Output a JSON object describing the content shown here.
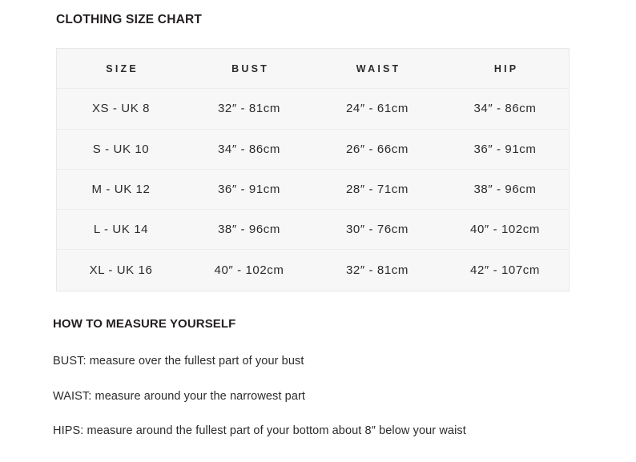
{
  "page": {
    "title": "CLOTHING SIZE CHART",
    "background_color": "#ffffff",
    "text_color": "#2b2b2b"
  },
  "size_table": {
    "background_color": "#f7f7f7",
    "border_color": "#e8e8e8",
    "columns": [
      "SIZE",
      "BUST",
      "WAIST",
      "HIP"
    ],
    "rows": [
      {
        "size": "XS - UK 8",
        "bust": "32″ - 81cm",
        "waist": "24″ - 61cm",
        "hip": "34″ - 86cm"
      },
      {
        "size": "S - UK 10",
        "bust": "34″ - 86cm",
        "waist": "26″ - 66cm",
        "hip": "36″ - 91cm"
      },
      {
        "size": "M - UK 12",
        "bust": "36″ - 91cm",
        "waist": "28″ - 71cm",
        "hip": "38″ - 96cm"
      },
      {
        "size": "L - UK 14",
        "bust": "38″ - 96cm",
        "waist": "30″ - 76cm",
        "hip": "40″ - 102cm"
      },
      {
        "size": "XL - UK 16",
        "bust": "40″ - 102cm",
        "waist": "32″ - 81cm",
        "hip": "42″ - 107cm"
      }
    ]
  },
  "measure_section": {
    "title": "HOW TO MEASURE YOURSELF",
    "instructions": [
      "BUST: measure over the fullest part of your bust",
      "WAIST: measure around your the narrowest part",
      "HIPS: measure around the fullest part of your bottom about 8″ below your waist"
    ]
  },
  "chart_data": {
    "type": "table",
    "title": "CLOTHING SIZE CHART",
    "columns": [
      "SIZE",
      "BUST",
      "WAIST",
      "HIP"
    ],
    "rows": [
      [
        "XS - UK 8",
        "32″ - 81cm",
        "24″ - 61cm",
        "34″ - 86cm"
      ],
      [
        "S - UK 10",
        "34″ - 86cm",
        "26″ - 66cm",
        "36″ - 91cm"
      ],
      [
        "M - UK 12",
        "36″ - 91cm",
        "28″ - 71cm",
        "38″ - 96cm"
      ],
      [
        "L - UK 14",
        "38″ - 96cm",
        "30″ - 76cm",
        "40″ - 102cm"
      ],
      [
        "XL - UK 16",
        "40″ - 102cm",
        "32″ - 81cm",
        "42″ - 107cm"
      ]
    ],
    "units": {
      "primary": "inches",
      "secondary": "centimetres"
    },
    "bust_inches": [
      32,
      34,
      36,
      38,
      40
    ],
    "bust_cm": [
      81,
      86,
      91,
      96,
      102
    ],
    "waist_inches": [
      24,
      26,
      28,
      30,
      32
    ],
    "waist_cm": [
      61,
      66,
      71,
      76,
      81
    ],
    "hip_inches": [
      34,
      36,
      38,
      40,
      42
    ],
    "hip_cm": [
      86,
      91,
      96,
      102,
      107
    ]
  }
}
